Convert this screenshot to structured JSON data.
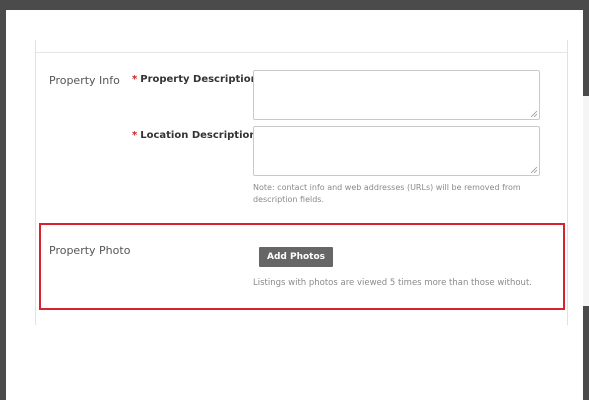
{
  "form": {
    "property_info_section": "Property Info",
    "fields": [
      {
        "required_mark": "*",
        "label": "Property Description",
        "value": ""
      },
      {
        "required_mark": "*",
        "label": "Location Description",
        "value": ""
      }
    ],
    "note": "Note: contact info and web addresses (URLs) will be removed from description fields."
  },
  "photo": {
    "section_label": "Property Photo",
    "button_label": "Add Photos",
    "hint": "Listings with photos are viewed 5 times more than those without."
  },
  "colors": {
    "highlight_border": "#d8222f",
    "button_bg": "#666666",
    "required_asterisk": "#cc1f1f"
  }
}
